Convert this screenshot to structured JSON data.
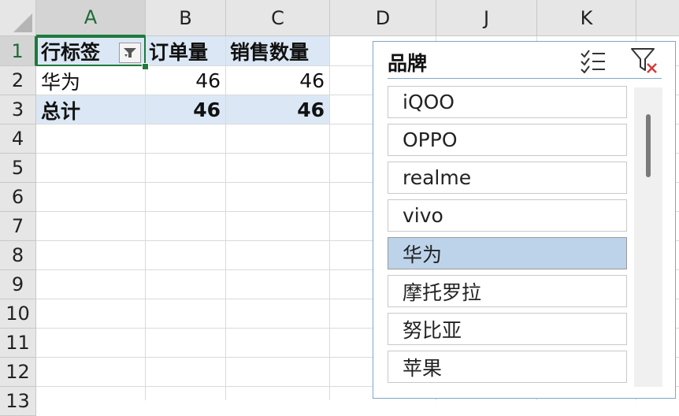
{
  "columns": [
    "A",
    "B",
    "C",
    "D",
    "J",
    "K"
  ],
  "rows": [
    "1",
    "2",
    "3",
    "4",
    "5",
    "6",
    "7",
    "8",
    "9",
    "10",
    "11",
    "12",
    "13"
  ],
  "pivot": {
    "header": {
      "label": "行标签",
      "orders": "订单量",
      "quantity": "销售数量"
    },
    "rows": [
      {
        "label": "华为",
        "orders": "46",
        "quantity": "46"
      }
    ],
    "total": {
      "label": "总计",
      "orders": "46",
      "quantity": "46"
    }
  },
  "slicer": {
    "title": "品牌",
    "items": [
      {
        "label": "iQOO",
        "selected": false
      },
      {
        "label": "OPPO",
        "selected": false
      },
      {
        "label": "realme",
        "selected": false
      },
      {
        "label": "vivo",
        "selected": false
      },
      {
        "label": "华为",
        "selected": true
      },
      {
        "label": "摩托罗拉",
        "selected": false
      },
      {
        "label": "努比亚",
        "selected": false
      },
      {
        "label": "苹果",
        "selected": false
      }
    ]
  },
  "colors": {
    "accent": "#1d7a3b",
    "band": "#dbe7f4",
    "selected_item": "#bdd3ea"
  }
}
